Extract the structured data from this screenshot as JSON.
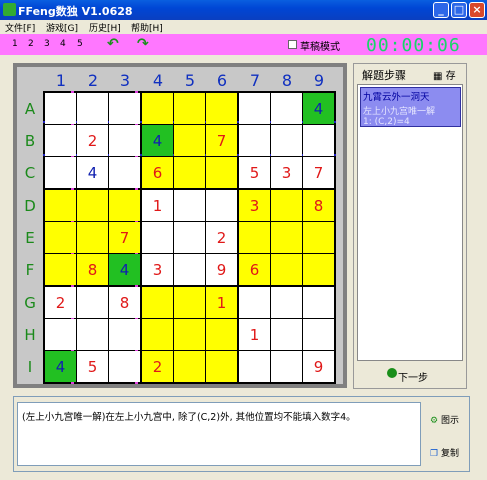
{
  "window": {
    "title": "FFeng数独 V1.0628",
    "min_label": "_",
    "max_label": "□",
    "close_label": "×"
  },
  "menu": [
    "文件[F]",
    "游戏[G]",
    "历史[H]",
    "帮助[H]"
  ],
  "toolbar": {
    "levels": [
      "1",
      "2",
      "3",
      "4",
      "5"
    ],
    "back_label": "↶",
    "forward_label": "↷",
    "draft_mode_label": "草稿模式",
    "timer": "00:00:06"
  },
  "board": {
    "col_headers": [
      "1",
      "2",
      "3",
      "4",
      "5",
      "6",
      "7",
      "8",
      "9"
    ],
    "row_headers": [
      "A",
      "B",
      "C",
      "D",
      "E",
      "F",
      "G",
      "H",
      "I"
    ],
    "cells": [
      [
        "",
        "",
        "",
        "",
        "",
        "",
        "",
        "",
        "4"
      ],
      [
        "",
        "2",
        "",
        "4",
        "",
        "7",
        "",
        "",
        ""
      ],
      [
        "",
        "4",
        "",
        "6",
        "",
        "",
        "5",
        "3",
        "7"
      ],
      [
        "",
        "",
        "",
        "1",
        "",
        "",
        "3",
        "",
        "8"
      ],
      [
        "",
        "",
        "7",
        "",
        "",
        "2",
        "",
        "",
        ""
      ],
      [
        "",
        "8",
        "4",
        "3",
        "",
        "9",
        "6",
        "",
        ""
      ],
      [
        "2",
        "",
        "8",
        "",
        "",
        "1",
        "",
        "",
        ""
      ],
      [
        "",
        "",
        "",
        "",
        "",
        "",
        "1",
        "",
        ""
      ],
      [
        "4",
        "5",
        "",
        "2",
        "",
        "",
        "",
        "",
        "9"
      ]
    ],
    "colors": {
      "yellow": "#FFFF00",
      "white": "#FFFFFF",
      "green": "#22C022",
      "red_digit": "#E01818",
      "blue_digit": "#1020B0"
    }
  },
  "steps": {
    "title": "解题步骤",
    "save_label": "存",
    "item": {
      "line1": "九霄云外一洞天",
      "line2": "左上小九宫唯一解",
      "line3": "1: (C,2)=4"
    },
    "next_label": "下一步"
  },
  "explanation": {
    "text": "(左上小九宫唯一解)在左上小九宫中, 除了(C,2)外, 其他位置均不能填入数字4。",
    "hint_label": "图示",
    "copy_label": "复制"
  }
}
